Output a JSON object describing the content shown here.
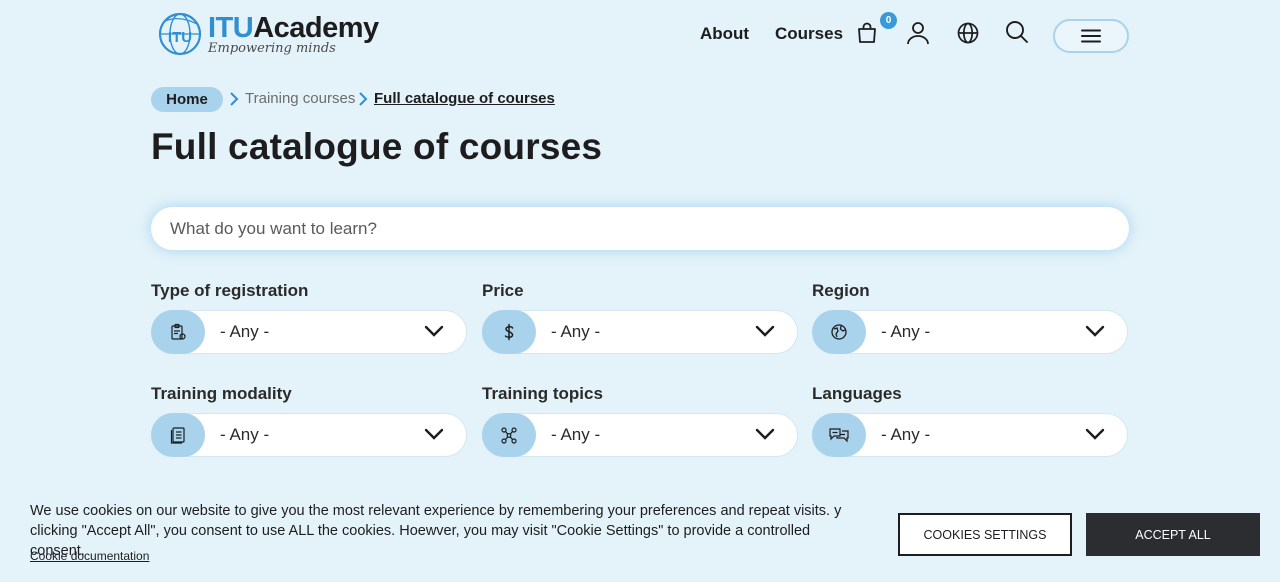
{
  "header": {
    "logo_itu": "ITU",
    "logo_academy": "Academy",
    "logo_tagline": "Empowering minds",
    "logo_badge": "ITU",
    "nav": {
      "about": "About",
      "courses": "Courses"
    },
    "cart_count": "0",
    "icons": [
      "cart-icon",
      "user-icon",
      "globe-icon",
      "search-icon",
      "hamburger-icon"
    ]
  },
  "breadcrumb": {
    "home": "Home",
    "training": "Training courses",
    "current": "Full catalogue of courses"
  },
  "page": {
    "title": "Full catalogue of courses"
  },
  "search": {
    "placeholder": "What do you want to learn?"
  },
  "filters": [
    {
      "label": "Type of registration",
      "value": "- Any -",
      "icon": "registration-icon"
    },
    {
      "label": "Price",
      "value": "- Any -",
      "icon": "dollar-icon"
    },
    {
      "label": "Region",
      "value": "- Any -",
      "icon": "region-globe-icon"
    },
    {
      "label": "Training modality",
      "value": "- Any -",
      "icon": "document-icon"
    },
    {
      "label": "Training topics",
      "value": "- Any -",
      "icon": "network-icon"
    },
    {
      "label": "Languages",
      "value": "- Any -",
      "icon": "chat-bubbles-icon"
    }
  ],
  "cookie": {
    "text": "We use cookies on our website to give you the most relevant experience by remembering your preferences and repeat visits. y clicking \"Accept All\", you consent to use ALL the cookies. Hoewver, you may visit \"Cookie Settings\" to provide a controlled consent.",
    "doc_link": "Cookie documentation",
    "settings_btn": "COOKIES SETTINGS",
    "accept_btn": "ACCEPT ALL"
  },
  "colors": {
    "background": "#e4f3f9",
    "accent": "#a9d3ec",
    "brand_blue": "#2f8fd1",
    "dark_button": "#2b2d31"
  }
}
